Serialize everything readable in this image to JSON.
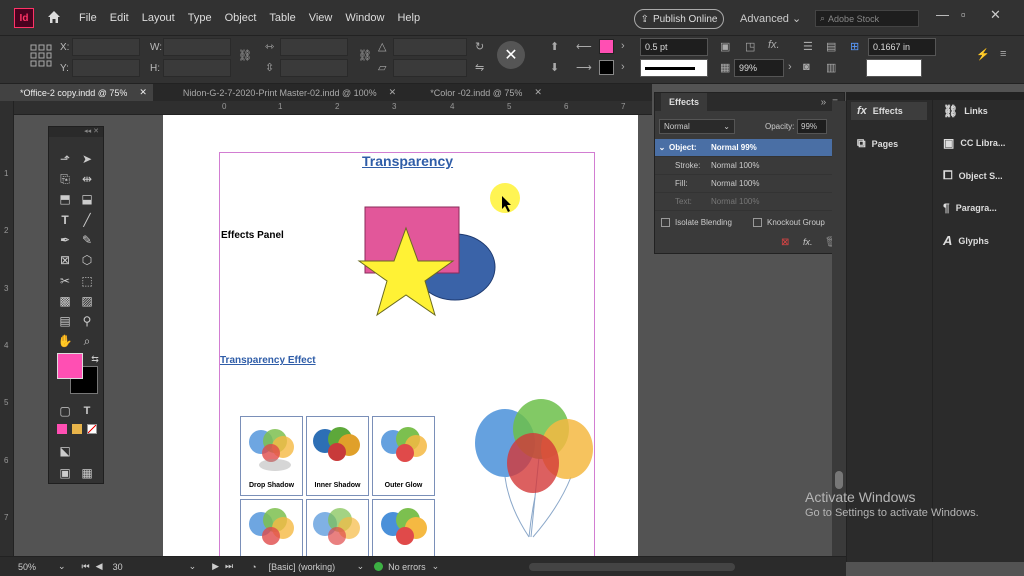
{
  "app": {
    "icon_text": "Id",
    "menu": [
      "File",
      "Edit",
      "Layout",
      "Type",
      "Object",
      "Table",
      "View",
      "Window",
      "Help"
    ],
    "publish_label": "Publish Online",
    "workspace": "Advanced",
    "search_placeholder": "Adobe Stock"
  },
  "control": {
    "x_label": "X:",
    "y_label": "Y:",
    "w_label": "W:",
    "h_label": "H:",
    "stroke_weight": "0.5 pt",
    "opacity": "99%",
    "offset": "0.1667 in"
  },
  "tabs": [
    {
      "label": "*Office-2 copy.indd @ 75%",
      "active": true
    },
    {
      "label": "Nidon-G-2-7-2020-Print Master-02.indd @ 100%",
      "active": false
    },
    {
      "label": "*Color -02.indd @ 75%",
      "active": false
    }
  ],
  "ruler": {
    "h": [
      "0",
      "1",
      "2",
      "3",
      "4",
      "5",
      "6",
      "7"
    ],
    "v": [
      "1",
      "2",
      "3",
      "4",
      "5",
      "6",
      "7"
    ]
  },
  "document": {
    "title": "Transparency",
    "effects_panel_label": "Effects Panel",
    "transparency_effect_label": "Transparency Effect",
    "thumbs": [
      "Drop Shadow",
      "Inner Shadow",
      "Outer Glow"
    ]
  },
  "effects_panel": {
    "tab": "Effects",
    "blend_mode": "Normal",
    "opacity_label": "Opacity:",
    "opacity_value": "99%",
    "rows": [
      {
        "name": "Object:",
        "value": "Normal 99%",
        "selected": true
      },
      {
        "name": "Stroke:",
        "value": "Normal 100%",
        "selected": false
      },
      {
        "name": "Fill:",
        "value": "Normal 100%",
        "selected": false
      },
      {
        "name": "Text:",
        "value": "Normal 100%",
        "selected": false
      }
    ],
    "isolate": "Isolate Blending",
    "knockout": "Knockout Group"
  },
  "dock": {
    "col1": [
      {
        "icon": "fx-icon",
        "label": "Effects"
      },
      {
        "icon": "pages-icon",
        "label": "Pages"
      }
    ],
    "col2": [
      {
        "icon": "links-icon",
        "label": "Links"
      },
      {
        "icon": "cc-libraries-icon",
        "label": "CC Libra..."
      },
      {
        "icon": "object-styles-icon",
        "label": "Object S..."
      },
      {
        "icon": "paragraph-styles-icon",
        "label": "Paragra..."
      },
      {
        "icon": "glyphs-icon",
        "label": "Glyphs"
      }
    ]
  },
  "status": {
    "zoom": "50%",
    "page": "30",
    "style": "[Basic] (working)",
    "errors": "No errors"
  },
  "watermark": {
    "line1": "Activate Windows",
    "line2": "Go to Settings to activate Windows."
  },
  "colors": {
    "fill_swatch": "#ff4fb3",
    "accent": "#4a6fa5",
    "star": "#fff235",
    "rect": "#e2579a",
    "ellipse": "#3a63a8"
  }
}
